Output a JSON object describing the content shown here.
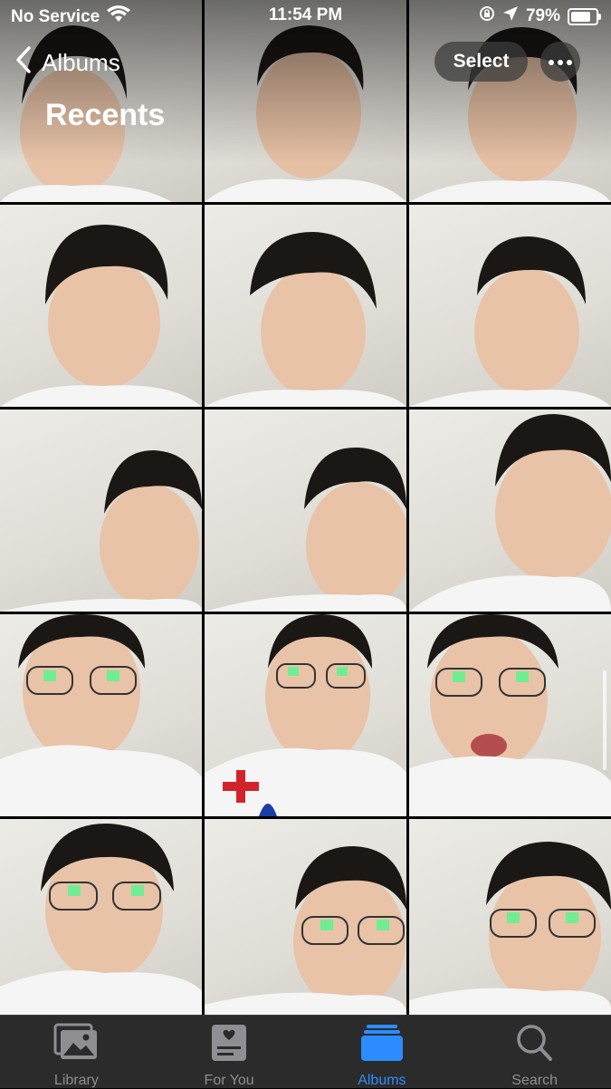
{
  "status_bar": {
    "carrier": "No Service",
    "time": "11:54 PM",
    "battery_percent": "79%",
    "battery_level": 0.79
  },
  "nav": {
    "back_label": "Albums",
    "title": "Recents",
    "select_label": "Select"
  },
  "photos": [
    {
      "label": "photo-1"
    },
    {
      "label": "photo-2"
    },
    {
      "label": "photo-3"
    },
    {
      "label": "photo-4"
    },
    {
      "label": "photo-5"
    },
    {
      "label": "photo-6"
    },
    {
      "label": "photo-7"
    },
    {
      "label": "photo-8"
    },
    {
      "label": "photo-9"
    },
    {
      "label": "photo-10"
    },
    {
      "label": "photo-11"
    },
    {
      "label": "photo-12"
    },
    {
      "label": "photo-13"
    },
    {
      "label": "photo-14"
    },
    {
      "label": "photo-15"
    }
  ],
  "tabs": [
    {
      "label": "Library",
      "icon": "photo-library-icon",
      "active": false
    },
    {
      "label": "For You",
      "icon": "for-you-icon",
      "active": false
    },
    {
      "label": "Albums",
      "icon": "albums-icon",
      "active": true
    },
    {
      "label": "Search",
      "icon": "search-icon",
      "active": false
    }
  ],
  "colors": {
    "accent": "#2c8cff",
    "tab_inactive": "#8e8e93",
    "tab_bar_bg": "#2b2b2b"
  }
}
